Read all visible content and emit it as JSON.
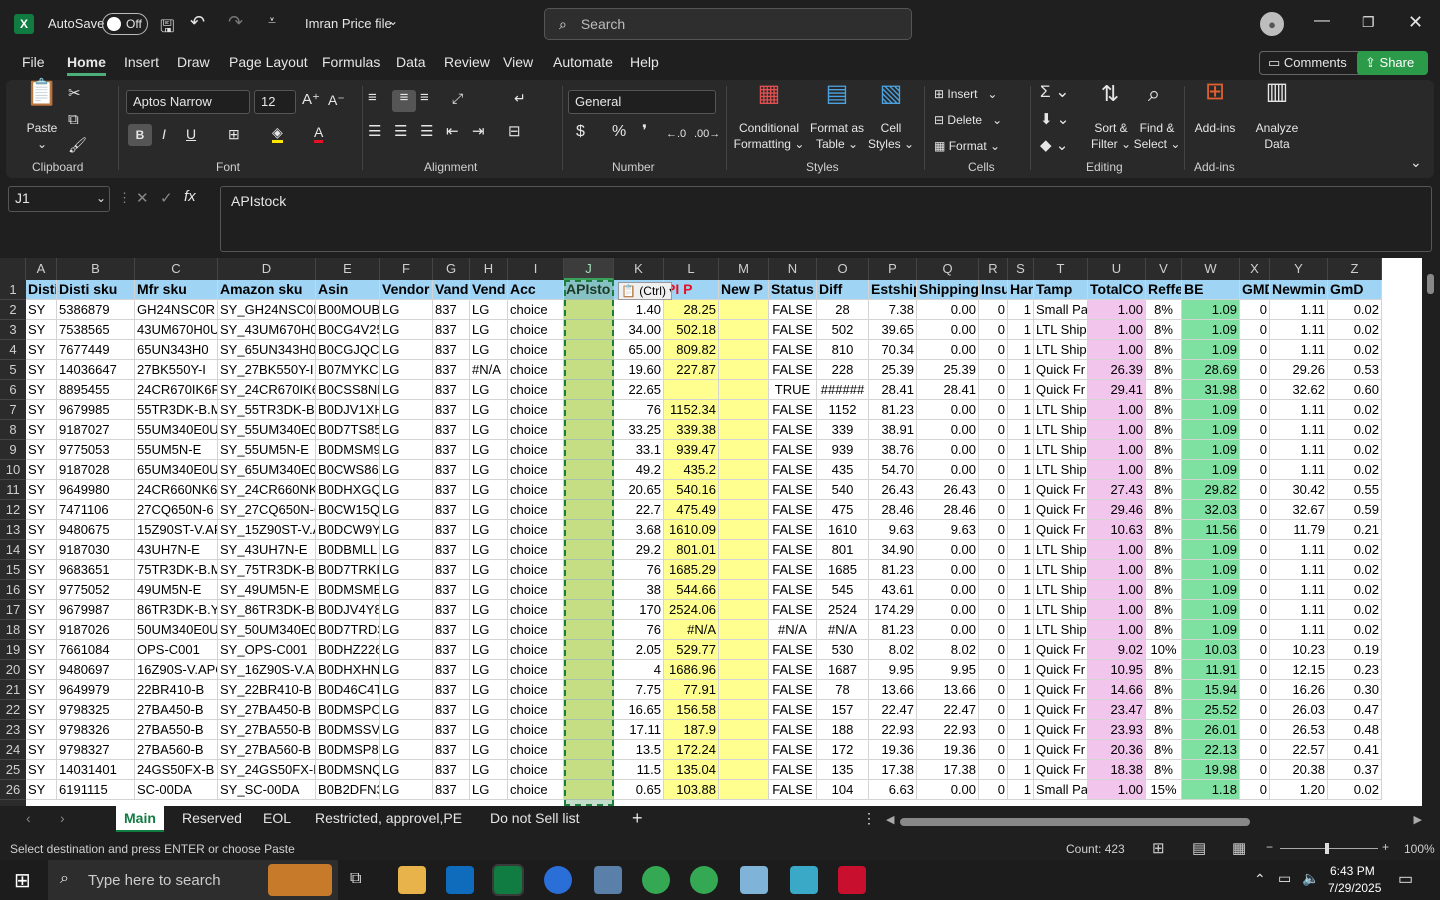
{
  "app": {
    "autosave_label": "AutoSave",
    "autosave_state": "Off",
    "file_title": "Imran Price file",
    "search_placeholder": "Search"
  },
  "menu": [
    "File",
    "Home",
    "Insert",
    "Draw",
    "Page Layout",
    "Formulas",
    "Data",
    "Review",
    "View",
    "Automate",
    "Help"
  ],
  "buttons": {
    "comments": "Comments",
    "share": "Share"
  },
  "ribbon": {
    "paste": "Paste",
    "font_name": "Aptos Narrow",
    "font_size": "12",
    "number_format": "General",
    "conditional": "Conditional",
    "formatting": "Formatting",
    "format_as": "Format as",
    "table": "Table",
    "cell": "Cell",
    "styles_btn": "Styles",
    "insert": "Insert",
    "delete": "Delete",
    "format": "Format",
    "sort": "Sort &",
    "filter": "Filter",
    "find": "Find &",
    "select": "Select",
    "addins_btn": "Add-ins",
    "analyze": "Analyze",
    "data": "Data",
    "groups": [
      "Clipboard",
      "Font",
      "Alignment",
      "Number",
      "Styles",
      "Cells",
      "Editing",
      "Add-ins"
    ]
  },
  "formula_bar": {
    "name_box": "J1",
    "content": "APIstock"
  },
  "columns": [
    "A",
    "B",
    "C",
    "D",
    "E",
    "F",
    "G",
    "H",
    "I",
    "J",
    "K",
    "L",
    "M",
    "N",
    "O",
    "P",
    "Q",
    "R",
    "S",
    "T",
    "U",
    "V",
    "W",
    "X",
    "Y",
    "Z"
  ],
  "header_row": [
    "Disti",
    "Disti sku",
    "Mfr sku",
    "Amazon sku",
    "Asin",
    "Vendor",
    "Vando",
    "Vend",
    "Acc",
    "APIsto",
    "",
    "PI P",
    "New P",
    "Status",
    "Diff",
    "Estship",
    "Shipping",
    "Insu",
    "Han",
    "Tamp",
    "TotalCO",
    "Reffe",
    "BE",
    "GMD",
    "Newmin",
    "GmD"
  ],
  "paste_tag": "(Ctrl)",
  "rows": [
    [
      "2",
      "SY",
      "5386879",
      "GH24NSC0R",
      "SY_GH24NSC0R",
      "B00MOUB",
      "LG",
      "837",
      "LG",
      "choice",
      "",
      "1.40",
      "28.25",
      "",
      "FALSE",
      "28",
      "7.38",
      "0.00",
      "0",
      "1",
      "Small Pa",
      "1.00",
      "8%",
      "1.09",
      "0",
      "1.11",
      "0.02"
    ],
    [
      "3",
      "SY",
      "7538565",
      "43UM670H0U",
      "SY_43UM670H0U",
      "B0CG4V25",
      "LG",
      "837",
      "LG",
      "choice",
      "",
      "34.00",
      "502.18",
      "",
      "FALSE",
      "502",
      "39.65",
      "0.00",
      "0",
      "1",
      "LTL Ship",
      "1.00",
      "8%",
      "1.09",
      "0",
      "1.11",
      "0.02"
    ],
    [
      "4",
      "SY",
      "7677449",
      "65UN343H0",
      "SY_65UN343H0",
      "B0CGJQCJ",
      "LG",
      "837",
      "LG",
      "choice",
      "",
      "65.00",
      "809.82",
      "",
      "FALSE",
      "810",
      "70.34",
      "0.00",
      "0",
      "1",
      "LTL Ship",
      "1.00",
      "8%",
      "1.09",
      "0",
      "1.11",
      "0.02"
    ],
    [
      "5",
      "SY",
      "14036647",
      "27BK550Y-I",
      "SY_27BK550Y-I",
      "B07MYKC2",
      "LG",
      "837",
      "#N/A",
      "choice",
      "",
      "19.60",
      "227.87",
      "",
      "FALSE",
      "228",
      "25.39",
      "25.39",
      "0",
      "1",
      "Quick Fr",
      "26.39",
      "8%",
      "28.69",
      "0",
      "29.26",
      "0.53"
    ],
    [
      "6",
      "SY",
      "8895455",
      "24CR670IK6P",
      "SY_24CR670IK6P",
      "B0CSS8NK",
      "LG",
      "837",
      "LG",
      "choice",
      "",
      "22.65",
      "",
      "",
      "TRUE",
      "######",
      "28.41",
      "28.41",
      "0",
      "1",
      "Quick Fr",
      "29.41",
      "8%",
      "31.98",
      "0",
      "32.62",
      "0.60"
    ],
    [
      "7",
      "SY",
      "9679985",
      "55TR3DK-B.M",
      "SY_55TR3DK-B.M",
      "B0DJV1XH",
      "LG",
      "837",
      "LG",
      "choice",
      "",
      "76",
      "1152.34",
      "",
      "FALSE",
      "1152",
      "81.23",
      "0.00",
      "0",
      "1",
      "LTL Ship",
      "1.00",
      "8%",
      "1.09",
      "0",
      "1.11",
      "0.02"
    ],
    [
      "8",
      "SY",
      "9187027",
      "55UM340E0U",
      "SY_55UM340E0U",
      "B0D7TS85",
      "LG",
      "837",
      "LG",
      "choice",
      "",
      "33.25",
      "339.38",
      "",
      "FALSE",
      "339",
      "38.91",
      "0.00",
      "0",
      "1",
      "LTL Ship",
      "1.00",
      "8%",
      "1.09",
      "0",
      "1.11",
      "0.02"
    ],
    [
      "9",
      "SY",
      "9775053",
      "55UM5N-E",
      "SY_55UM5N-E",
      "B0DMSM9",
      "LG",
      "837",
      "LG",
      "choice",
      "",
      "33.1",
      "939.47",
      "",
      "FALSE",
      "939",
      "38.76",
      "0.00",
      "0",
      "1",
      "LTL Ship",
      "1.00",
      "8%",
      "1.09",
      "0",
      "1.11",
      "0.02"
    ],
    [
      "10",
      "SY",
      "9187028",
      "65UM340E0U",
      "SY_65UM340E0U",
      "B0CWS86L",
      "LG",
      "837",
      "LG",
      "choice",
      "",
      "49.2",
      "435.2",
      "",
      "FALSE",
      "435",
      "54.70",
      "0.00",
      "0",
      "1",
      "LTL Ship",
      "1.00",
      "8%",
      "1.09",
      "0",
      "1.11",
      "0.02"
    ],
    [
      "11",
      "SY",
      "9649980",
      "24CR660NK6",
      "SY_24CR660NK6",
      "B0DHXGQ",
      "LG",
      "837",
      "LG",
      "choice",
      "",
      "20.65",
      "540.16",
      "",
      "FALSE",
      "540",
      "26.43",
      "26.43",
      "0",
      "1",
      "Quick Fr",
      "27.43",
      "8%",
      "29.82",
      "0",
      "30.42",
      "0.55"
    ],
    [
      "12",
      "SY",
      "7471106",
      "27CQ650N-6",
      "SY_27CQ650N-6",
      "B0CW15Q",
      "LG",
      "837",
      "LG",
      "choice",
      "",
      "22.7",
      "475.49",
      "",
      "FALSE",
      "475",
      "28.46",
      "28.46",
      "0",
      "1",
      "Quick Fr",
      "29.46",
      "8%",
      "32.03",
      "0",
      "32.67",
      "0.59"
    ],
    [
      "13",
      "SY",
      "9480675",
      "15Z90ST-V.AF",
      "SY_15Z90ST-V.AF",
      "B0DCW9Y",
      "LG",
      "837",
      "LG",
      "choice",
      "",
      "3.68",
      "1610.09",
      "",
      "FALSE",
      "1610",
      "9.63",
      "9.63",
      "0",
      "1",
      "Quick Fr",
      "10.63",
      "8%",
      "11.56",
      "0",
      "11.79",
      "0.21"
    ],
    [
      "14",
      "SY",
      "9187030",
      "43UH7N-E",
      "SY_43UH7N-E",
      "B0DBMLL",
      "LG",
      "837",
      "LG",
      "choice",
      "",
      "29.2",
      "801.01",
      "",
      "FALSE",
      "801",
      "34.90",
      "0.00",
      "0",
      "1",
      "LTL Ship",
      "1.00",
      "8%",
      "1.09",
      "0",
      "1.11",
      "0.02"
    ],
    [
      "15",
      "SY",
      "9683651",
      "75TR3DK-B.M",
      "SY_75TR3DK-B.M",
      "B0D7TRKP",
      "LG",
      "837",
      "LG",
      "choice",
      "",
      "76",
      "1685.29",
      "",
      "FALSE",
      "1685",
      "81.23",
      "0.00",
      "0",
      "1",
      "LTL Ship",
      "1.00",
      "8%",
      "1.09",
      "0",
      "1.11",
      "0.02"
    ],
    [
      "16",
      "SY",
      "9775052",
      "49UM5N-E",
      "SY_49UM5N-E",
      "B0DMSMB",
      "LG",
      "837",
      "LG",
      "choice",
      "",
      "38",
      "544.66",
      "",
      "FALSE",
      "545",
      "43.61",
      "0.00",
      "0",
      "1",
      "LTL Ship",
      "1.00",
      "8%",
      "1.09",
      "0",
      "1.11",
      "0.02"
    ],
    [
      "17",
      "SY",
      "9679987",
      "86TR3DK-B.Y",
      "SY_86TR3DK-B.Y",
      "B0DJV4Y8",
      "LG",
      "837",
      "LG",
      "choice",
      "",
      "170",
      "2524.06",
      "",
      "FALSE",
      "2524",
      "174.29",
      "0.00",
      "0",
      "1",
      "LTL Ship",
      "1.00",
      "8%",
      "1.09",
      "0",
      "1.11",
      "0.02"
    ],
    [
      "18",
      "SY",
      "9187026",
      "50UM340E0U",
      "SY_50UM340E0U",
      "B0D7TRD3",
      "LG",
      "837",
      "LG",
      "choice",
      "",
      "76",
      "#N/A",
      "",
      "#N/A",
      "#N/A",
      "81.23",
      "0.00",
      "0",
      "1",
      "LTL Ship",
      "1.00",
      "8%",
      "1.09",
      "0",
      "1.11",
      "0.02"
    ],
    [
      "19",
      "SY",
      "7661084",
      "OPS-C001",
      "SY_OPS-C001",
      "B0DHZ226",
      "LG",
      "837",
      "LG",
      "choice",
      "",
      "2.05",
      "529.77",
      "",
      "FALSE",
      "530",
      "8.02",
      "8.02",
      "0",
      "1",
      "Quick Fr",
      "9.02",
      "10%",
      "10.03",
      "0",
      "10.23",
      "0.19"
    ],
    [
      "20",
      "SY",
      "9480697",
      "16Z90S-V.APC",
      "SY_16Z90S-V.APC",
      "B0DHXHN",
      "LG",
      "837",
      "LG",
      "choice",
      "",
      "4",
      "1686.96",
      "",
      "FALSE",
      "1687",
      "9.95",
      "9.95",
      "0",
      "1",
      "Quick Fr",
      "10.95",
      "8%",
      "11.91",
      "0",
      "12.15",
      "0.23"
    ],
    [
      "21",
      "SY",
      "9649979",
      "22BR410-B",
      "SY_22BR410-B",
      "B0D46C4T",
      "LG",
      "837",
      "LG",
      "choice",
      "",
      "7.75",
      "77.91",
      "",
      "FALSE",
      "78",
      "13.66",
      "13.66",
      "0",
      "1",
      "Quick Fr",
      "14.66",
      "8%",
      "15.94",
      "0",
      "16.26",
      "0.30"
    ],
    [
      "22",
      "SY",
      "9798325",
      "27BA450-B",
      "SY_27BA450-B",
      "B0DMSPC",
      "LG",
      "837",
      "LG",
      "choice",
      "",
      "16.65",
      "156.58",
      "",
      "FALSE",
      "157",
      "22.47",
      "22.47",
      "0",
      "1",
      "Quick Fr",
      "23.47",
      "8%",
      "25.52",
      "0",
      "26.03",
      "0.47"
    ],
    [
      "23",
      "SY",
      "9798326",
      "27BA550-B",
      "SY_27BA550-B",
      "B0DMSSV",
      "LG",
      "837",
      "LG",
      "choice",
      "",
      "17.11",
      "187.9",
      "",
      "FALSE",
      "188",
      "22.93",
      "22.93",
      "0",
      "1",
      "Quick Fr",
      "23.93",
      "8%",
      "26.01",
      "0",
      "26.53",
      "0.48"
    ],
    [
      "24",
      "SY",
      "9798327",
      "27BA560-B",
      "SY_27BA560-B",
      "B0DMSP8",
      "LG",
      "837",
      "LG",
      "choice",
      "",
      "13.5",
      "172.24",
      "",
      "FALSE",
      "172",
      "19.36",
      "19.36",
      "0",
      "1",
      "Quick Fr",
      "20.36",
      "8%",
      "22.13",
      "0",
      "22.57",
      "0.41"
    ],
    [
      "25",
      "SY",
      "14031401",
      "24GS50FX-B",
      "SY_24GS50FX-B",
      "B0DMSNQ",
      "LG",
      "837",
      "LG",
      "choice",
      "",
      "11.5",
      "135.04",
      "",
      "FALSE",
      "135",
      "17.38",
      "17.38",
      "0",
      "1",
      "Quick Fr",
      "18.38",
      "8%",
      "19.98",
      "0",
      "20.38",
      "0.37"
    ],
    [
      "26",
      "SY",
      "6191115",
      "SC-00DA",
      "SY_SC-00DA",
      "B0B2DFN3",
      "LG",
      "837",
      "LG",
      "choice",
      "",
      "0.65",
      "103.88",
      "",
      "FALSE",
      "104",
      "6.63",
      "0.00",
      "0",
      "1",
      "Small Pa",
      "1.00",
      "15%",
      "1.18",
      "0",
      "1.20",
      "0.02"
    ]
  ],
  "sheets": [
    "Main",
    "Reserved",
    "EOL",
    "Restricted, approvel,PE",
    "Do not Sell list"
  ],
  "status": {
    "message": "Select destination and press ENTER or choose Paste",
    "count": "Count: 423",
    "zoom": "100%"
  },
  "taskbar": {
    "search_placeholder": "Type here to search",
    "time": "6:43 PM",
    "date": "7/29/2025"
  },
  "colors": {
    "header_fill": "#9fd4f5",
    "yellow": "#ffff8f",
    "pink": "#f2c5ec",
    "green": "#7fe1a1",
    "accent": "#2b9b4a"
  }
}
